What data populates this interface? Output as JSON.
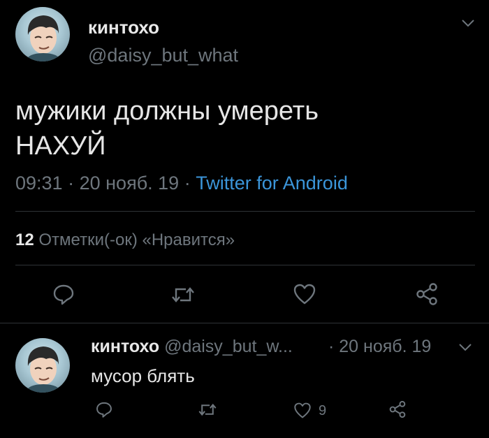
{
  "tweet": {
    "display_name": "кинтохо",
    "handle": "@daisy_but_what",
    "text_line1": "мужики должны умереть",
    "text_line2": "НАХУЙ",
    "time": "09:31",
    "dot": "·",
    "date": "20 нояб. 19",
    "source": "Twitter for Android",
    "likes_count": "12",
    "likes_label": "Отметки(-ок) «Нравится»",
    "icons": [
      "chevron-down-icon",
      "reply-icon",
      "retweet-icon",
      "heart-icon",
      "share-icon"
    ]
  },
  "reply": {
    "display_name": "кинтохо",
    "handle": "@daisy_but_w...",
    "dot": "·",
    "date": "20 нояб. 19",
    "text": "мусор блять",
    "like_count": "9",
    "icons": [
      "chevron-down-icon",
      "reply-icon",
      "retweet-icon",
      "heart-icon",
      "share-icon"
    ]
  },
  "colors": {
    "background": "#000000",
    "text": "#d9d9d9",
    "muted": "#6e767d",
    "link": "#3b95d9",
    "divider": "#2f3336"
  }
}
